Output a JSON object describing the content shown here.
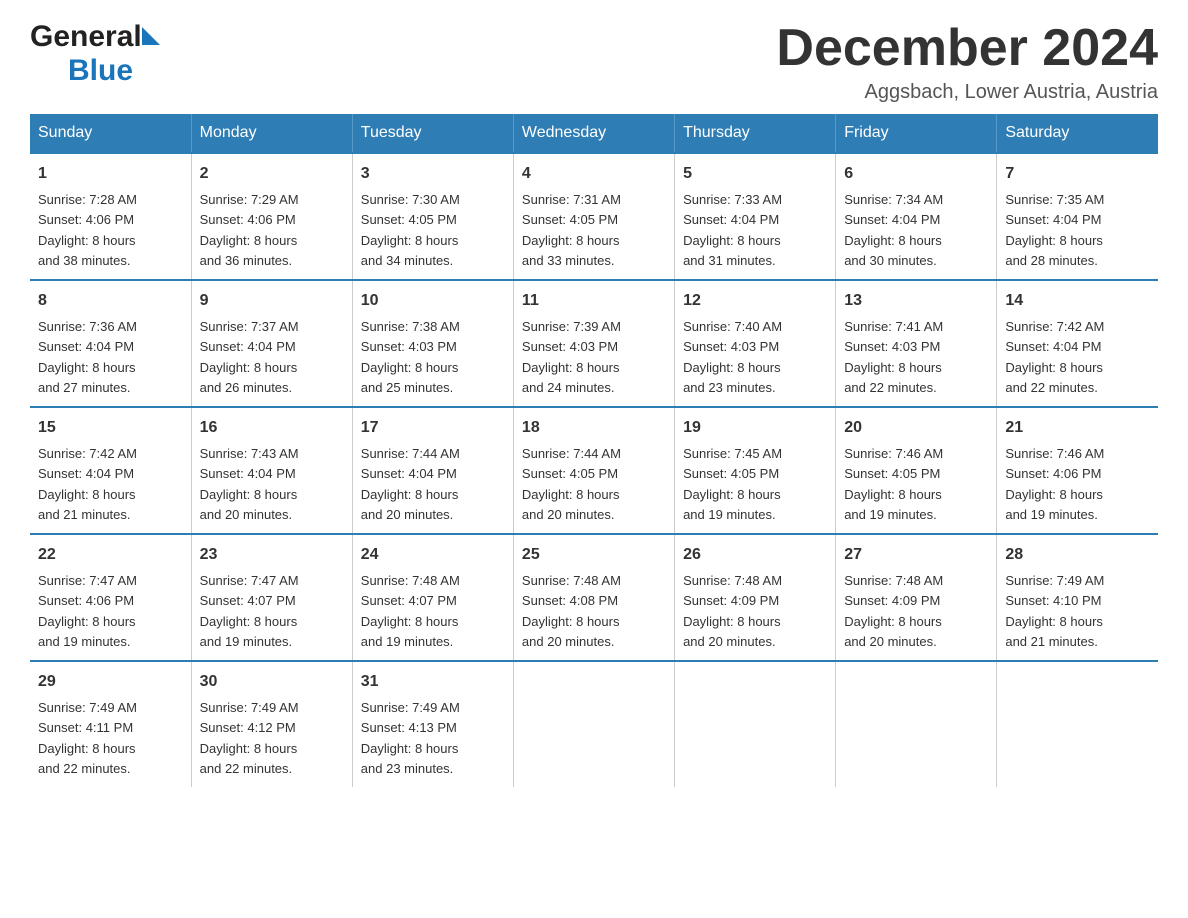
{
  "header": {
    "month_title": "December 2024",
    "location": "Aggsbach, Lower Austria, Austria",
    "logo_general": "General",
    "logo_blue": "Blue"
  },
  "days_of_week": [
    "Sunday",
    "Monday",
    "Tuesday",
    "Wednesday",
    "Thursday",
    "Friday",
    "Saturday"
  ],
  "weeks": [
    [
      {
        "day": "1",
        "sunrise": "7:28 AM",
        "sunset": "4:06 PM",
        "daylight": "8 hours and 38 minutes."
      },
      {
        "day": "2",
        "sunrise": "7:29 AM",
        "sunset": "4:06 PM",
        "daylight": "8 hours and 36 minutes."
      },
      {
        "day": "3",
        "sunrise": "7:30 AM",
        "sunset": "4:05 PM",
        "daylight": "8 hours and 34 minutes."
      },
      {
        "day": "4",
        "sunrise": "7:31 AM",
        "sunset": "4:05 PM",
        "daylight": "8 hours and 33 minutes."
      },
      {
        "day": "5",
        "sunrise": "7:33 AM",
        "sunset": "4:04 PM",
        "daylight": "8 hours and 31 minutes."
      },
      {
        "day": "6",
        "sunrise": "7:34 AM",
        "sunset": "4:04 PM",
        "daylight": "8 hours and 30 minutes."
      },
      {
        "day": "7",
        "sunrise": "7:35 AM",
        "sunset": "4:04 PM",
        "daylight": "8 hours and 28 minutes."
      }
    ],
    [
      {
        "day": "8",
        "sunrise": "7:36 AM",
        "sunset": "4:04 PM",
        "daylight": "8 hours and 27 minutes."
      },
      {
        "day": "9",
        "sunrise": "7:37 AM",
        "sunset": "4:04 PM",
        "daylight": "8 hours and 26 minutes."
      },
      {
        "day": "10",
        "sunrise": "7:38 AM",
        "sunset": "4:03 PM",
        "daylight": "8 hours and 25 minutes."
      },
      {
        "day": "11",
        "sunrise": "7:39 AM",
        "sunset": "4:03 PM",
        "daylight": "8 hours and 24 minutes."
      },
      {
        "day": "12",
        "sunrise": "7:40 AM",
        "sunset": "4:03 PM",
        "daylight": "8 hours and 23 minutes."
      },
      {
        "day": "13",
        "sunrise": "7:41 AM",
        "sunset": "4:03 PM",
        "daylight": "8 hours and 22 minutes."
      },
      {
        "day": "14",
        "sunrise": "7:42 AM",
        "sunset": "4:04 PM",
        "daylight": "8 hours and 22 minutes."
      }
    ],
    [
      {
        "day": "15",
        "sunrise": "7:42 AM",
        "sunset": "4:04 PM",
        "daylight": "8 hours and 21 minutes."
      },
      {
        "day": "16",
        "sunrise": "7:43 AM",
        "sunset": "4:04 PM",
        "daylight": "8 hours and 20 minutes."
      },
      {
        "day": "17",
        "sunrise": "7:44 AM",
        "sunset": "4:04 PM",
        "daylight": "8 hours and 20 minutes."
      },
      {
        "day": "18",
        "sunrise": "7:44 AM",
        "sunset": "4:05 PM",
        "daylight": "8 hours and 20 minutes."
      },
      {
        "day": "19",
        "sunrise": "7:45 AM",
        "sunset": "4:05 PM",
        "daylight": "8 hours and 19 minutes."
      },
      {
        "day": "20",
        "sunrise": "7:46 AM",
        "sunset": "4:05 PM",
        "daylight": "8 hours and 19 minutes."
      },
      {
        "day": "21",
        "sunrise": "7:46 AM",
        "sunset": "4:06 PM",
        "daylight": "8 hours and 19 minutes."
      }
    ],
    [
      {
        "day": "22",
        "sunrise": "7:47 AM",
        "sunset": "4:06 PM",
        "daylight": "8 hours and 19 minutes."
      },
      {
        "day": "23",
        "sunrise": "7:47 AM",
        "sunset": "4:07 PM",
        "daylight": "8 hours and 19 minutes."
      },
      {
        "day": "24",
        "sunrise": "7:48 AM",
        "sunset": "4:07 PM",
        "daylight": "8 hours and 19 minutes."
      },
      {
        "day": "25",
        "sunrise": "7:48 AM",
        "sunset": "4:08 PM",
        "daylight": "8 hours and 20 minutes."
      },
      {
        "day": "26",
        "sunrise": "7:48 AM",
        "sunset": "4:09 PM",
        "daylight": "8 hours and 20 minutes."
      },
      {
        "day": "27",
        "sunrise": "7:48 AM",
        "sunset": "4:09 PM",
        "daylight": "8 hours and 20 minutes."
      },
      {
        "day": "28",
        "sunrise": "7:49 AM",
        "sunset": "4:10 PM",
        "daylight": "8 hours and 21 minutes."
      }
    ],
    [
      {
        "day": "29",
        "sunrise": "7:49 AM",
        "sunset": "4:11 PM",
        "daylight": "8 hours and 22 minutes."
      },
      {
        "day": "30",
        "sunrise": "7:49 AM",
        "sunset": "4:12 PM",
        "daylight": "8 hours and 22 minutes."
      },
      {
        "day": "31",
        "sunrise": "7:49 AM",
        "sunset": "4:13 PM",
        "daylight": "8 hours and 23 minutes."
      },
      null,
      null,
      null,
      null
    ]
  ],
  "labels": {
    "sunrise": "Sunrise: ",
    "sunset": "Sunset: ",
    "daylight": "Daylight: "
  }
}
